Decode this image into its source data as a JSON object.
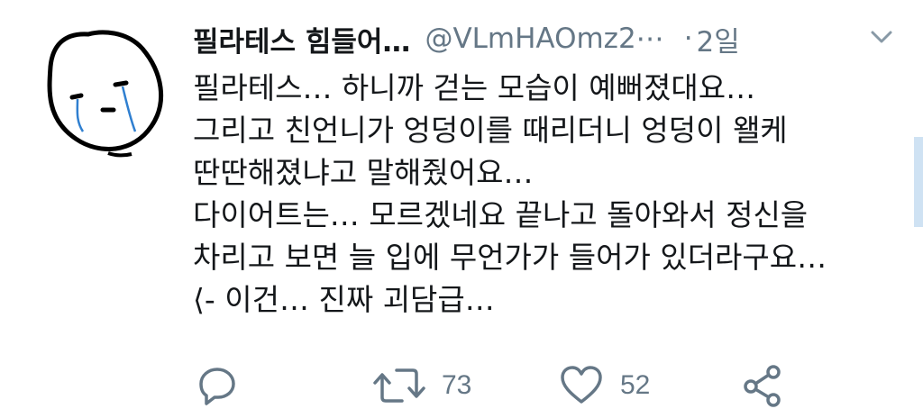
{
  "tweet": {
    "display_name": "필라테스 힘들어…",
    "handle": "@VLmHAOmz2⋯",
    "separator": "·",
    "time": "2일",
    "lines": [
      "필라테스… 하니까 걷는 모습이 예뻐졌대요…",
      "그리고 친언니가 엉덩이를 때리더니 엉덩이 왤케",
      "딴딴해졌냐고 말해줬어요…",
      "다이어트는… 모르겠네요 끝나고 돌아와서 정신을",
      "차리고 보면 늘 입에 무언가가 들어가 있더라구요…",
      "⟨- 이건… 진짜 괴담급…"
    ]
  },
  "actions": {
    "reply_icon": "reply-icon",
    "retweet_icon": "retweet-icon",
    "retweet_count": "73",
    "like_icon": "heart-icon",
    "like_count": "52",
    "share_icon": "share-icon"
  },
  "colors": {
    "text": "#14171a",
    "muted": "#657786",
    "background": "#ffffff"
  }
}
